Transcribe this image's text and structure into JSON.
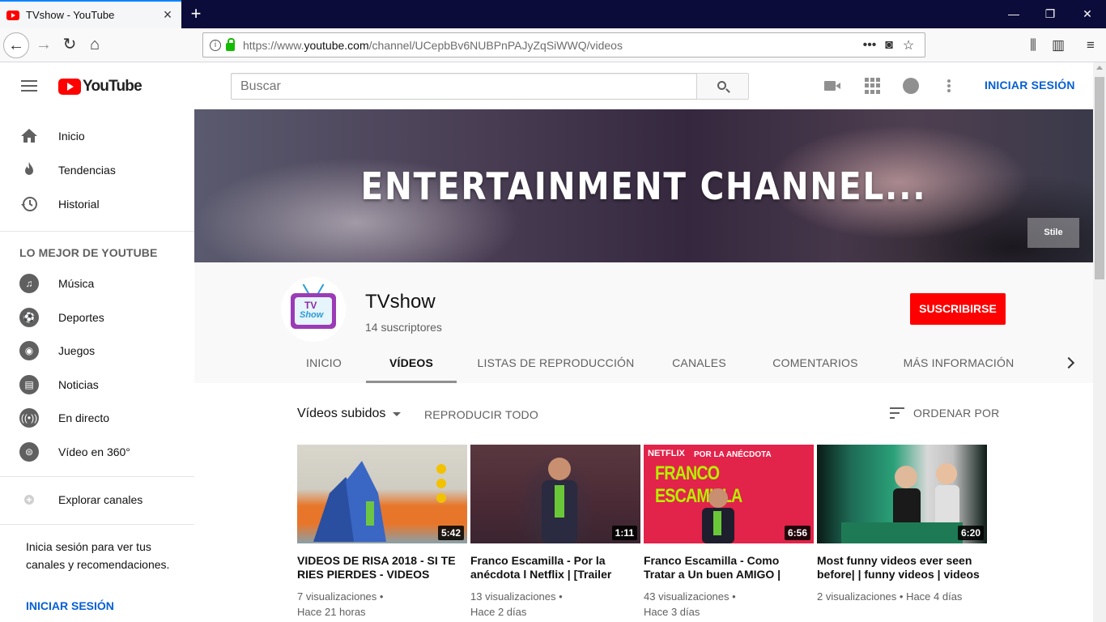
{
  "browser": {
    "tab_title": "TVshow - YouTube",
    "url_host_prefix": "https://www.",
    "url_host": "youtube.com",
    "url_path": "/channel/UCepbBv6NUBPnPAJyZqSiWWQ/videos"
  },
  "header": {
    "logo_text": "YouTube",
    "search_placeholder": "Buscar",
    "signin_label": "INICIAR SESIÓN"
  },
  "sidebar": {
    "main_items": [
      {
        "label": "Inicio",
        "icon": "home-icon"
      },
      {
        "label": "Tendencias",
        "icon": "flame-icon"
      },
      {
        "label": "Historial",
        "icon": "history-icon"
      }
    ],
    "best_heading": "LO MEJOR DE YOUTUBE",
    "best_items": [
      {
        "label": "Música",
        "icon": "music-icon"
      },
      {
        "label": "Deportes",
        "icon": "sports-icon"
      },
      {
        "label": "Juegos",
        "icon": "gaming-icon"
      },
      {
        "label": "Noticias",
        "icon": "news-icon"
      },
      {
        "label": "En directo",
        "icon": "live-icon"
      },
      {
        "label": "Vídeo en 360°",
        "icon": "video-360-icon"
      }
    ],
    "explore_label": "Explorar canales",
    "promo_text": "Inicia sesión para ver tus canales y recomendaciones.",
    "promo_signin": "INICIAR SESIÓN"
  },
  "banner": {
    "title": "ENTERTAINMENT CHANNEL...",
    "badge": "Stile"
  },
  "channel": {
    "name": "TVshow",
    "subscribers": "14 suscriptores",
    "avatar_text_1": "TV",
    "avatar_text_2": "Show",
    "subscribe_label": "SUSCRIBIRSE",
    "tabs": [
      "INICIO",
      "VÍDEOS",
      "LISTAS DE REPRODUCCIÓN",
      "CANALES",
      "COMENTARIOS",
      "MÁS INFORMACIÓN"
    ],
    "active_tab": "VÍDEOS"
  },
  "videos_section": {
    "uploads_label": "Vídeos subidos",
    "play_all_label": "REPRODUCIR TODO",
    "sort_label": "ORDENAR POR",
    "items": [
      {
        "title": "VIDEOS DE RISA 2018 - SI TE RIES PIERDES - VIDEOS",
        "duration": "5:42",
        "views": "7 visualizaciones",
        "age": "Hace 21 horas"
      },
      {
        "title": "Franco Escamilla - Por la anécdota l Netflix | [Trailer",
        "duration": "1:11",
        "views": "13 visualizaciones",
        "age": "Hace 2 días"
      },
      {
        "title": "Franco Escamilla - Como Tratar a Un buen AMIGO |",
        "duration": "6:56",
        "views": "43 visualizaciones",
        "age": "Hace 3 días",
        "thumb_text_1": "NETFLIX",
        "thumb_text_2": "POR LA ANÉCDOTA",
        "thumb_text_3": "FRANCO ESCAMILLA"
      },
      {
        "title": "Most funny videos ever seen before| | funny videos | videos",
        "duration": "6:20",
        "views": "2 visualizaciones",
        "age": "Hace 4 días"
      }
    ]
  },
  "colors": {
    "brand_red": "#ff0000",
    "link_blue": "#065fd4",
    "tabbar_bg": "#0c0c3a"
  }
}
